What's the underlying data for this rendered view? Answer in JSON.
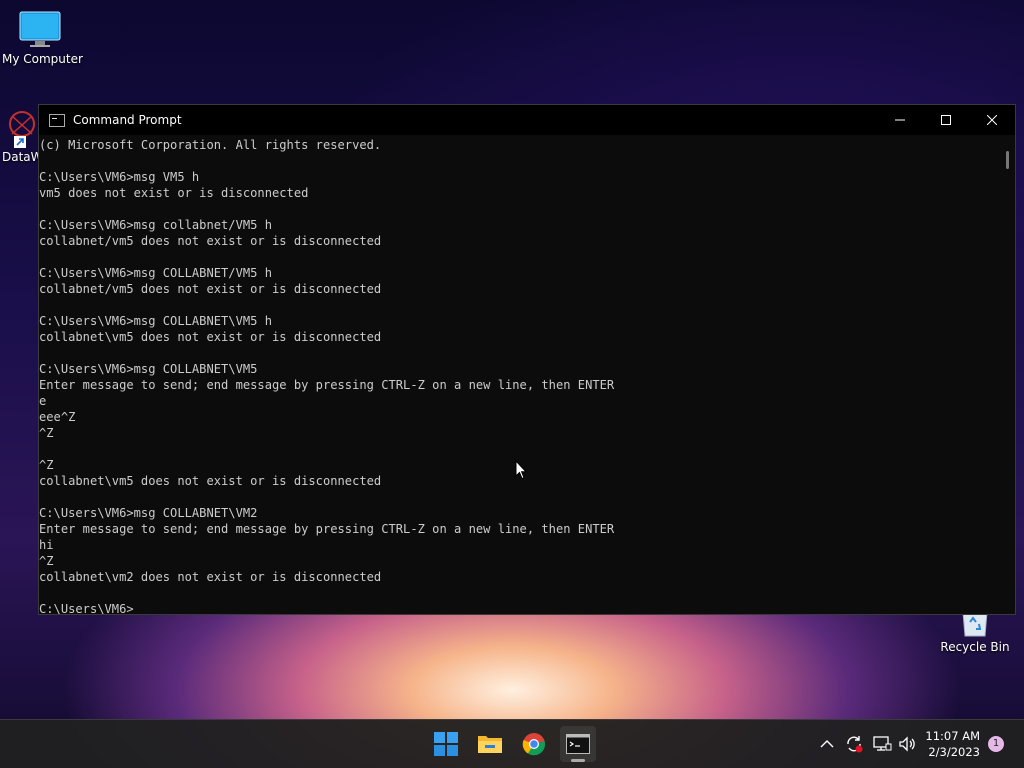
{
  "desktop": {
    "icons": [
      {
        "label": "My Computer"
      },
      {
        "label": "DataW"
      },
      {
        "label": "Recycle Bin"
      }
    ]
  },
  "window": {
    "title": "Command Prompt",
    "lines": [
      "(c) Microsoft Corporation. All rights reserved.",
      "",
      "C:\\Users\\VM6>msg VM5 h",
      "vm5 does not exist or is disconnected",
      "",
      "C:\\Users\\VM6>msg collabnet/VM5 h",
      "collabnet/vm5 does not exist or is disconnected",
      "",
      "C:\\Users\\VM6>msg COLLABNET/VM5 h",
      "collabnet/vm5 does not exist or is disconnected",
      "",
      "C:\\Users\\VM6>msg COLLABNET\\VM5 h",
      "collabnet\\vm5 does not exist or is disconnected",
      "",
      "C:\\Users\\VM6>msg COLLABNET\\VM5",
      "Enter message to send; end message by pressing CTRL-Z on a new line, then ENTER",
      "e",
      "eee^Z",
      "^Z",
      "",
      "^Z",
      "collabnet\\vm5 does not exist or is disconnected",
      "",
      "C:\\Users\\VM6>msg COLLABNET\\VM2",
      "Enter message to send; end message by pressing CTRL-Z on a new line, then ENTER",
      "hi",
      "^Z",
      "collabnet\\vm2 does not exist or is disconnected",
      "",
      "C:\\Users\\VM6>"
    ]
  },
  "taskbar": {
    "apps": [
      "start-icon",
      "file-explorer-icon",
      "chrome-icon",
      "command-prompt-icon"
    ],
    "clock": {
      "time": "11:07 AM",
      "date": "2/3/2023"
    },
    "notification_count": "1"
  },
  "colors": {
    "console_bg": "#0c0c0c",
    "console_text": "#cccccc",
    "taskbar": "#202020"
  }
}
